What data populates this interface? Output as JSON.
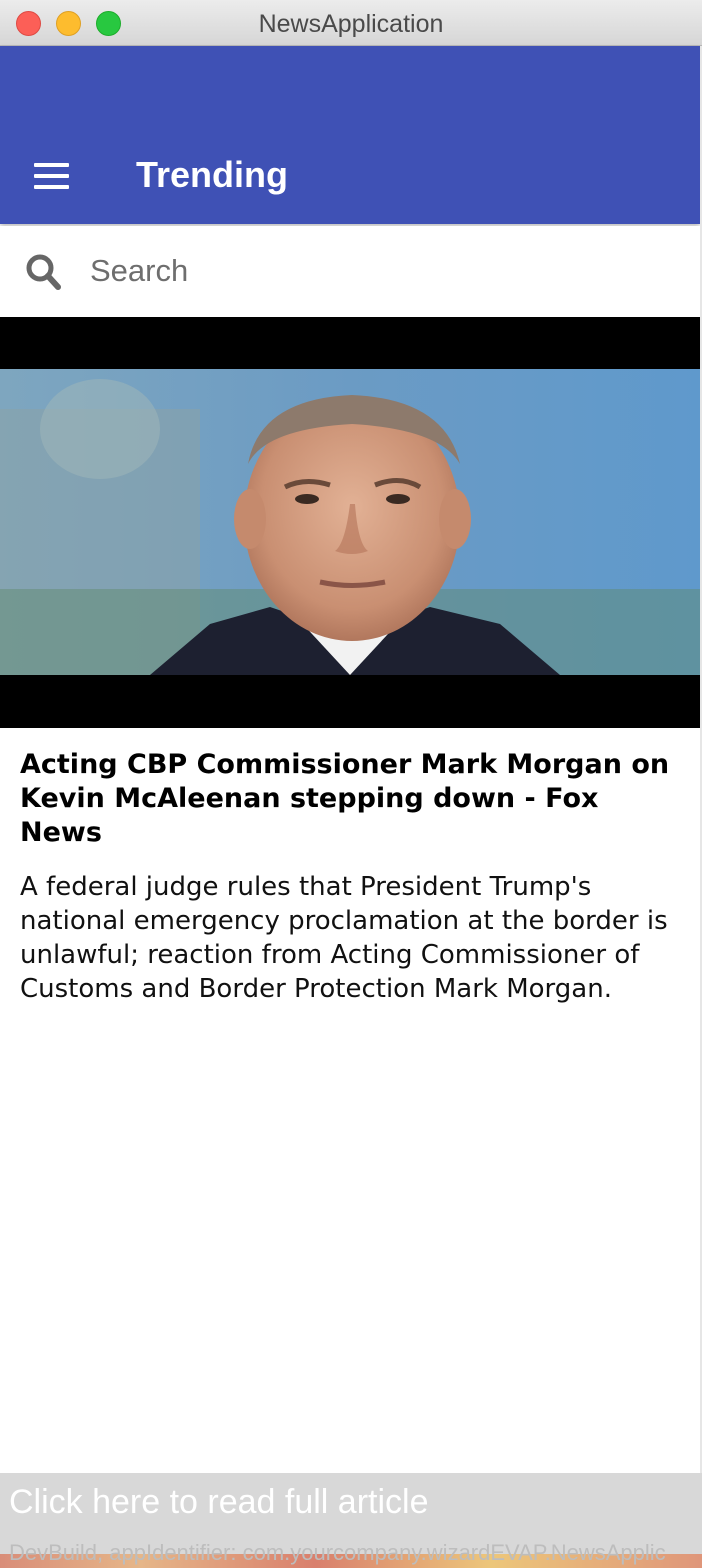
{
  "window": {
    "title": "NewsApplication"
  },
  "appbar": {
    "title": "Trending",
    "color": "#3f51b5"
  },
  "search": {
    "placeholder": "Search",
    "value": ""
  },
  "article": {
    "title": "Acting CBP Commissioner Mark Morgan on Kevin McAleenan stepping down - Fox News",
    "description": "A federal judge rules that President Trump's national emergency proclamation at the border is unlawful; reaction from Acting Commissioner of Customs and Border Protection Mark Morgan."
  },
  "footer": {
    "read_more_label": "Click here to read full article",
    "dev_label": "DevBuild, appIdentifier: com.yourcompany.wizardEVAP.NewsApplic"
  },
  "icons": {
    "menu": "hamburger-menu-icon",
    "search": "search-icon"
  }
}
